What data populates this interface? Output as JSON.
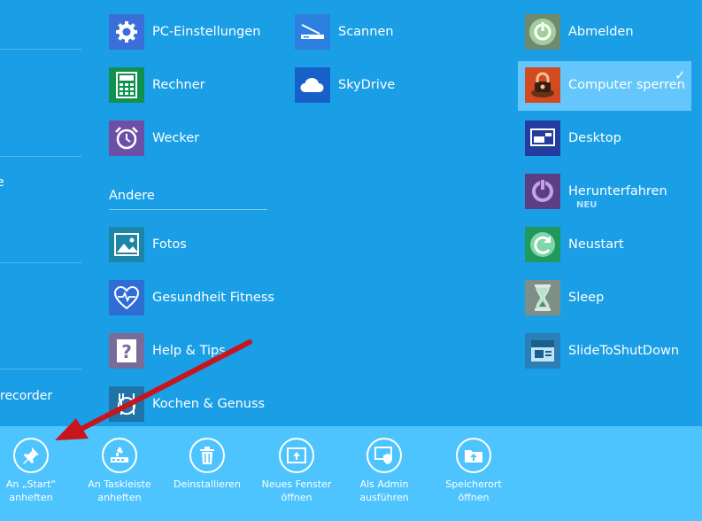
{
  "left_fragments": {
    "frag1": "e",
    "frag2": "recorder"
  },
  "tiles": {
    "pc_einstellungen": "PC-Einstellungen",
    "rechner": "Rechner",
    "wecker": "Wecker",
    "fotos": "Fotos",
    "gesundheit": "Gesundheit  Fitness",
    "help": "Help & Tips",
    "kochen": "Kochen & Genuss",
    "scannen": "Scannen",
    "skydrive": "SkyDrive",
    "abmelden": "Abmelden",
    "computer_sperren": "Computer sperren",
    "desktop": "Desktop",
    "herunterfahren": "Herunterfahren",
    "herunterfahren_badge": "NEU",
    "neustart": "Neustart",
    "sleep": "Sleep",
    "slidetoshutdown": "SlideToShutDown"
  },
  "group": {
    "andere": "Andere"
  },
  "selected_check": "✓",
  "appbar": {
    "pin_start": [
      "An „Start“",
      "anheften"
    ],
    "pin_taskbar": [
      "An Taskleiste",
      "anheften"
    ],
    "uninstall": [
      "Deinstallieren"
    ],
    "new_window": [
      "Neues Fenster",
      "öffnen"
    ],
    "run_admin": [
      "Als Admin",
      "ausführen"
    ],
    "open_location": [
      "Speicherort",
      "öffnen"
    ]
  },
  "colors": {
    "background": "#1a9fe6",
    "appbar": "#4ec4fe",
    "selected": "#64c6fb",
    "arrow": "#c8141c"
  }
}
